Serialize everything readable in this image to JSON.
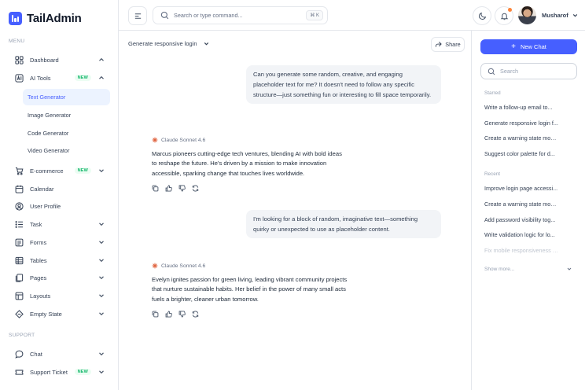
{
  "app": {
    "name": "TailAdmin"
  },
  "sidebar": {
    "menu_label": "MENU",
    "support_label": "SUPPORT",
    "items": [
      {
        "label": "Dashboard",
        "icon": "grid-icon"
      },
      {
        "label": "AI Tools",
        "icon": "ai-icon",
        "badge": "NEW"
      },
      {
        "label": "E-commerce",
        "icon": "cart-icon",
        "badge": "NEW"
      },
      {
        "label": "Calendar",
        "icon": "calendar-icon"
      },
      {
        "label": "User Profile",
        "icon": "user-circle-icon"
      },
      {
        "label": "Task",
        "icon": "task-icon"
      },
      {
        "label": "Forms",
        "icon": "form-icon"
      },
      {
        "label": "Tables",
        "icon": "table-icon"
      },
      {
        "label": "Pages",
        "icon": "pages-icon"
      },
      {
        "label": "Layouts",
        "icon": "layout-icon"
      },
      {
        "label": "Empty State",
        "icon": "empty-state-icon"
      }
    ],
    "ai_sub_items": [
      "Text Generator",
      "Image Generator",
      "Code Generator",
      "Video Generator"
    ],
    "support_items": [
      {
        "label": "Chat",
        "icon": "chat-icon"
      },
      {
        "label": "Support Ticket",
        "icon": "ticket-icon",
        "badge": "NEW"
      }
    ]
  },
  "header": {
    "search_placeholder": "Search or type command...",
    "shortcut": "⌘ K",
    "user_name": "Musharof"
  },
  "chat": {
    "title": "Generate responsive login",
    "share_label": "Share",
    "model_name": "Claude Sonnet 4.6",
    "messages": [
      {
        "role": "user",
        "text": "Can you generate some random, creative, and engaging placeholder text for me? It doesn't need to follow any specific structure—just something fun or interesting to fill space temporarily."
      },
      {
        "role": "assistant",
        "text": "Marcus pioneers cutting-edge tech ventures, blending AI with bold ideas to reshape the future. He's driven by a mission to make innovation accessible, sparking change that touches lives worldwide."
      },
      {
        "role": "user",
        "text": "I'm looking for a block of random, imaginative text—something quirky or unexpected to use as placeholder content."
      },
      {
        "role": "assistant",
        "text": "Evelyn ignites passion for green living, leading vibrant community projects that nurture sustainable habits. Her belief in the power of many small acts fuels a brighter, cleaner urban tomorrow."
      }
    ]
  },
  "history": {
    "new_chat_label": "New Chat",
    "search_placeholder": "Search",
    "starred_label": "Starred",
    "starred": [
      "Write a follow-up email to...",
      "Generate responsive login f...",
      "Create a warning state mod...",
      "Suggest color palette for d..."
    ],
    "recent_label": "Recent",
    "recent": [
      "Improve login page accessi...",
      "Create a warning state mod...",
      "Add password visibility tog...",
      "Write validation logic for lo...",
      "Fix mobile responsiveness o..."
    ],
    "show_more_label": "Show more..."
  },
  "colors": {
    "brand": "#465fff",
    "active_bg": "#ecf3ff",
    "badge_green": "#12b76a",
    "notification": "#fd853a"
  }
}
